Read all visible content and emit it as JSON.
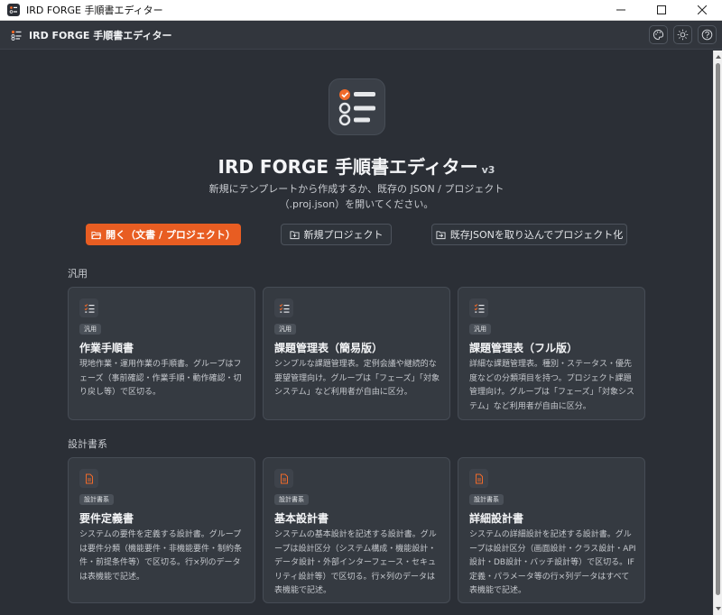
{
  "window": {
    "title": "IRD FORGE 手順書エディター"
  },
  "appbar": {
    "title": "IRD FORGE 手順書エディター",
    "tools": [
      "palette-icon",
      "sun-icon",
      "help-icon"
    ]
  },
  "hero": {
    "title": "IRD FORGE 手順書エディター",
    "version": "v3",
    "description": "新規にテンプレートから作成するか、既存の JSON / プロジェクト（.proj.json）を開いてください。"
  },
  "actions": {
    "open_label": "開く（文書 / プロジェクト）",
    "new_project_label": "新規プロジェクト",
    "import_label": "既存JSONを取り込んでプロジェクト化"
  },
  "sections": {
    "general": {
      "label": "汎用",
      "cards": [
        {
          "tag": "汎用",
          "title": "作業手順書",
          "desc": "現地作業・運用作業の手順書。グループはフェーズ（事前確認・作業手順・動作確認・切り戻し等）で区切る。"
        },
        {
          "tag": "汎用",
          "title": "課題管理表（簡易版）",
          "desc": "シンプルな課題管理表。定例会議や継続的な要望管理向け。グループは「フェーズ」「対象システム」など利用者が自由に区分。"
        },
        {
          "tag": "汎用",
          "title": "課題管理表（フル版）",
          "desc": "詳細な課題管理表。種別・ステータス・優先度などの分類項目を持つ。プロジェクト課題管理向け。グループは「フェーズ」「対象システム」など利用者が自由に区分。"
        }
      ]
    },
    "design": {
      "label": "設計書系",
      "cards": [
        {
          "tag": "設計書系",
          "title": "要件定義書",
          "desc": "システムの要件を定義する設計書。グループは要件分類（機能要件・非機能要件・制約条件・前提条件等）で区切る。行×列のデータは表機能で記述。"
        },
        {
          "tag": "設計書系",
          "title": "基本設計書",
          "desc": "システムの基本設計を記述する設計書。グループは設計区分（システム構成・機能設計・データ設計・外部インターフェース・セキュリティ設計等）で区切る。行×列のデータは表機能で記述。"
        },
        {
          "tag": "設計書系",
          "title": "詳細設計書",
          "desc": "システムの詳細設計を記述する設計書。グループは設計区分（画面設計・クラス設計・API設計・DB設計・バッチ設計等）で区切る。IF定義・パラメータ等の行×列データはすべて表機能で記述。"
        }
      ]
    }
  },
  "colors": {
    "accent": "#e85d22",
    "background": "#2b2f36",
    "card": "#353a41"
  }
}
